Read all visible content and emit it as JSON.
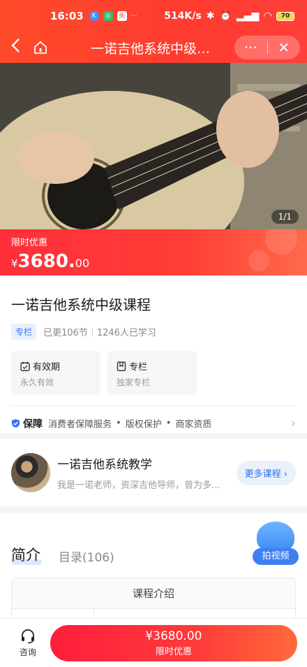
{
  "status_bar": {
    "time": "16:03",
    "network_speed": "514K/s",
    "battery": "70"
  },
  "nav": {
    "title": "一诺吉他系统中级…",
    "more_icon": "···",
    "close_icon": "✕"
  },
  "hero": {
    "image_counter": "1/1"
  },
  "price_bar": {
    "tag": "限时优惠",
    "currency": "¥",
    "price_int": "3680.",
    "price_cents": "00"
  },
  "course": {
    "title": "一诺吉他系统中级课程",
    "badge": "专栏",
    "updated": "已更106节",
    "learners": "1246人已学习",
    "cards": [
      {
        "title": "有效期",
        "sub": "永久有效"
      },
      {
        "title": "专栏",
        "sub": "独家专栏"
      }
    ],
    "guarantee": {
      "title": "保障",
      "items": [
        "消费者保障服务",
        "版权保护",
        "商家资质"
      ]
    }
  },
  "teacher": {
    "name": "一诺吉他系统教学",
    "desc": "我是一诺老师，资深吉他导师，曾为多…",
    "more_button": "更多课程"
  },
  "tabs": {
    "intro": "简介",
    "catalog": "目录(106)",
    "intro_header": "课程介绍"
  },
  "fab": {
    "label": "拍视频"
  },
  "bottom_bar": {
    "consult": "咨询",
    "buy_price": "¥3680.00",
    "buy_label": "限时优惠"
  },
  "colors": {
    "brand_red": "#ff3b2f",
    "accent_blue": "#3574f0"
  }
}
